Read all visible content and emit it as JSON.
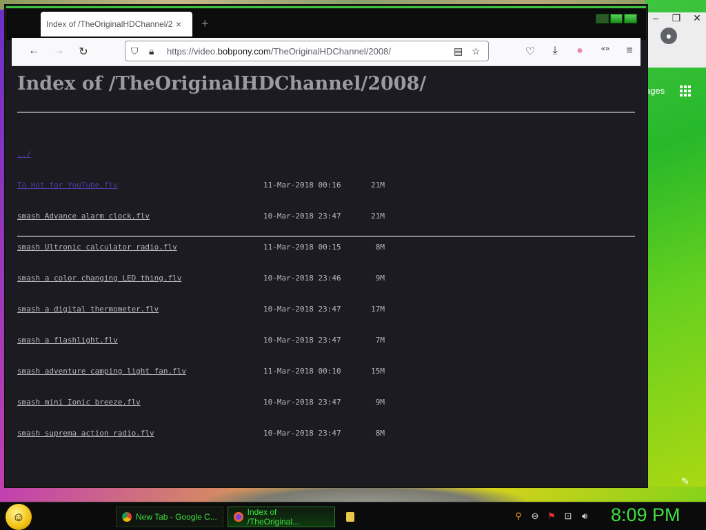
{
  "firefox": {
    "tab_title": "Index of /TheOriginalHDChannel/2008/",
    "tab_close": "×",
    "new_tab": "+",
    "url_prefix": "https://video.",
    "url_domain": "bobpony.com",
    "url_path": "/TheOriginalHDChannel/2008/",
    "toolbar_icons": [
      "back-icon",
      "forward-icon",
      "reload-icon",
      "shield-icon",
      "lock-icon",
      "reader-icon",
      "bookmark-star-icon",
      "pocket-icon",
      "download-icon",
      "pride-flag-icon",
      "extension-icon",
      "menu-icon"
    ]
  },
  "page": {
    "heading": "Index of /TheOriginalHDChannel/2008/",
    "parent_link": "../",
    "files": [
      {
        "name": "To Hot for YouTube.flv",
        "date": "11-Mar-2018 00:16",
        "size": "21M",
        "visited": true
      },
      {
        "name": "smash Advance alarm clock.flv",
        "date": "10-Mar-2018 23:47",
        "size": "21M",
        "visited": false
      },
      {
        "name": "smash Ultronic calculator radio.flv",
        "date": "11-Mar-2018 00:15",
        "size": "8M",
        "visited": false
      },
      {
        "name": "smash a color changing LED thing.flv",
        "date": "10-Mar-2018 23:46",
        "size": "9M",
        "visited": false
      },
      {
        "name": "smash a digital thermometer.flv",
        "date": "10-Mar-2018 23:47",
        "size": "17M",
        "visited": false
      },
      {
        "name": "smash a flashlight.flv",
        "date": "10-Mar-2018 23:47",
        "size": "7M",
        "visited": false
      },
      {
        "name": "smash adventure camping light fan.flv",
        "date": "11-Mar-2018 00:10",
        "size": "15M",
        "visited": false
      },
      {
        "name": "smash mini Ionic breeze.flv",
        "date": "10-Mar-2018 23:47",
        "size": "9M",
        "visited": false
      },
      {
        "name": "smash suprema action radio.flv",
        "date": "10-Mar-2018 23:47",
        "size": "8M",
        "visited": false
      }
    ]
  },
  "chrome_background": {
    "images_link": "ages"
  },
  "taskbar": {
    "items": [
      {
        "label": "New Tab - Google C...",
        "icon": "chrome-icon"
      },
      {
        "label": "Index of /TheOriginal...",
        "icon": "firefox-icon"
      }
    ],
    "clock": "8:09 PM"
  },
  "colors": {
    "accent_green": "#3fe13f",
    "page_bg": "#1c1b22",
    "visited_link": "#4b3fa0"
  }
}
